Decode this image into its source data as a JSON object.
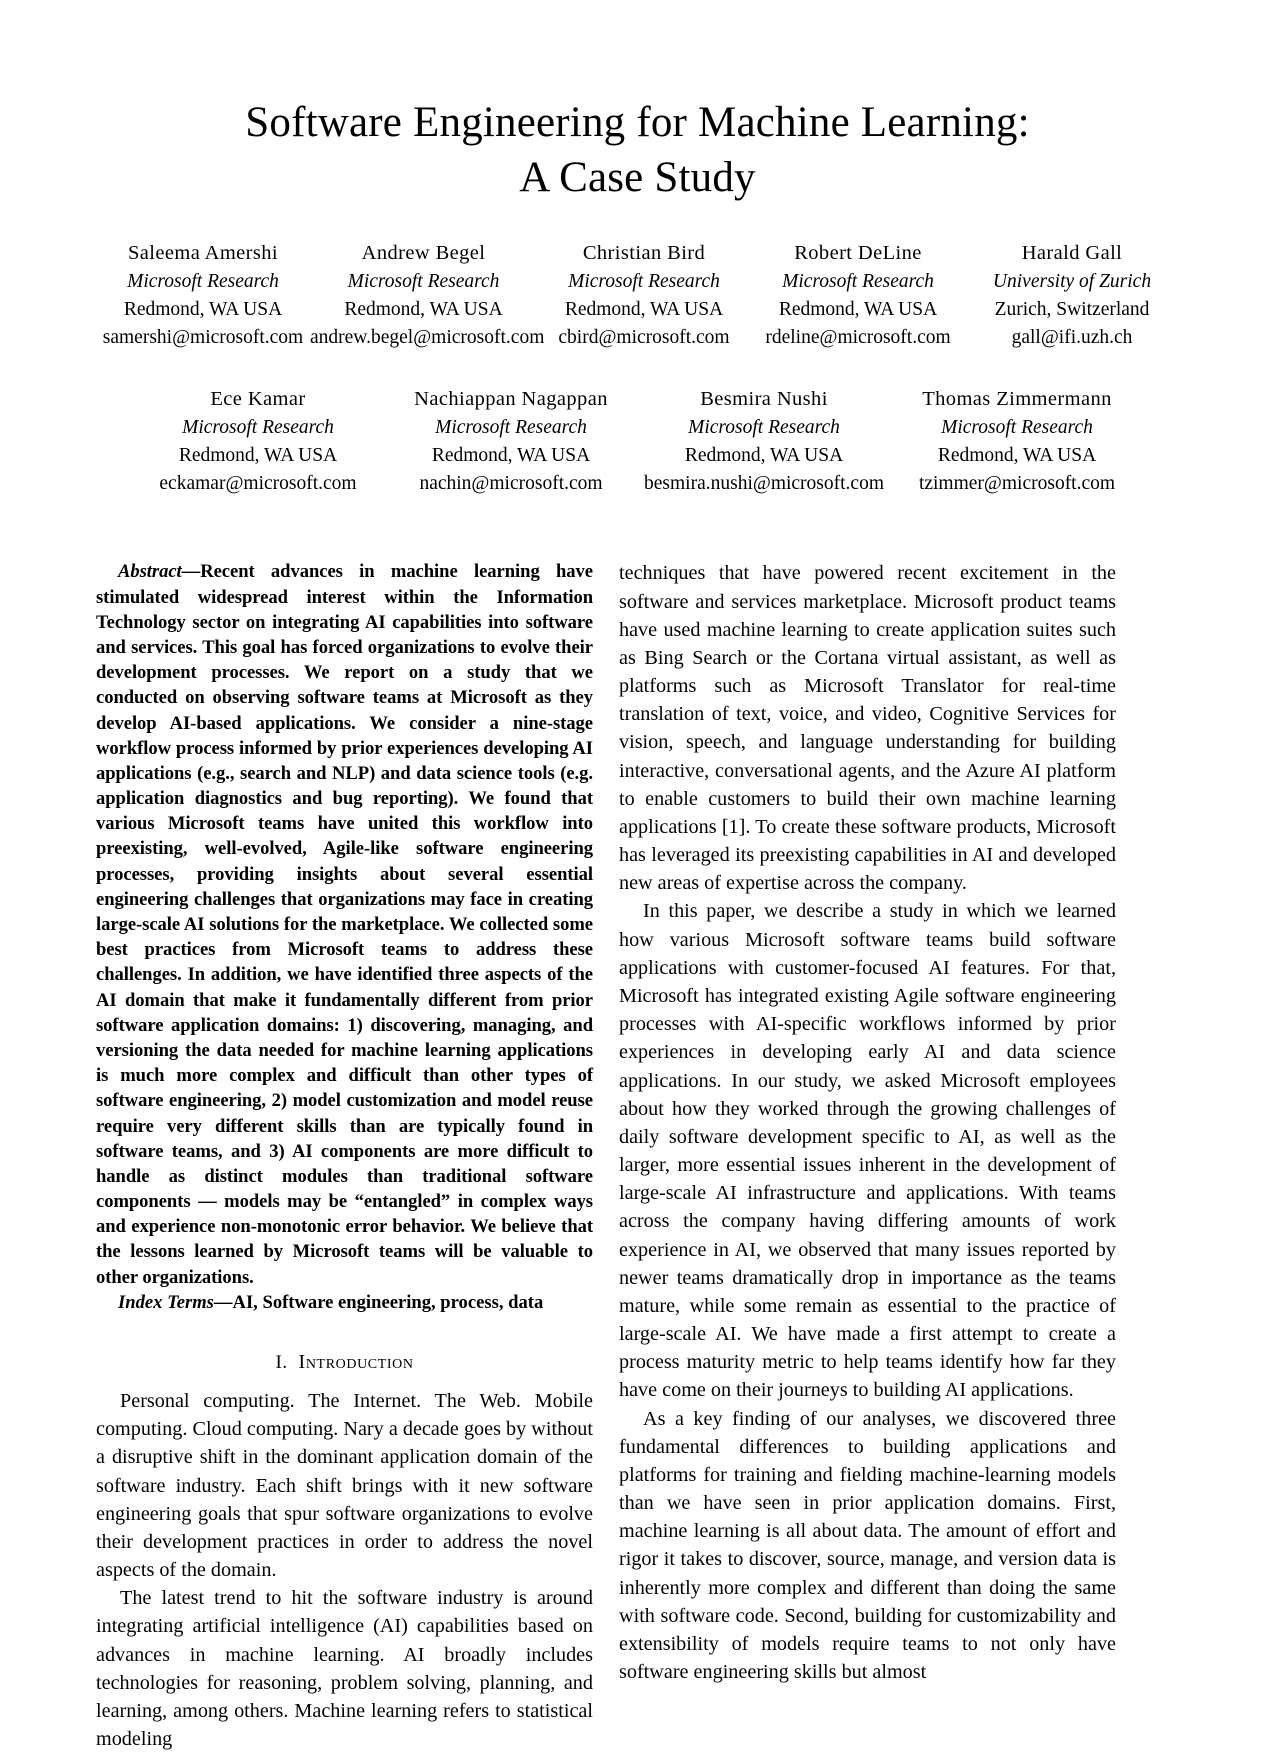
{
  "paper": {
    "title_lines": [
      "Software Engineering for Machine Learning:",
      "A Case Study"
    ],
    "authors_row1": [
      {
        "name": "Saleema Amershi",
        "affiliation": "Microsoft Research",
        "location": "Redmond, WA USA",
        "email": "samershi@microsoft.com"
      },
      {
        "name": "Andrew Begel",
        "affiliation": "Microsoft Research",
        "location": "Redmond, WA USA",
        "email": "andrew.begel@microsoft.com"
      },
      {
        "name": "Christian Bird",
        "affiliation": "Microsoft Research",
        "location": "Redmond, WA USA",
        "email": "cbird@microsoft.com"
      },
      {
        "name": "Robert DeLine",
        "affiliation": "Microsoft Research",
        "location": "Redmond, WA USA",
        "email": "rdeline@microsoft.com"
      },
      {
        "name": "Harald Gall",
        "affiliation": "University of Zurich",
        "location": "Zurich, Switzerland",
        "email": "gall@ifi.uzh.ch"
      }
    ],
    "authors_row2": [
      {
        "name": "Ece Kamar",
        "affiliation": "Microsoft Research",
        "location": "Redmond, WA USA",
        "email": "eckamar@microsoft.com"
      },
      {
        "name": "Nachiappan Nagappan",
        "affiliation": "Microsoft Research",
        "location": "Redmond, WA USA",
        "email": "nachin@microsoft.com"
      },
      {
        "name": "Besmira Nushi",
        "affiliation": "Microsoft Research",
        "location": "Redmond, WA USA",
        "email": "besmira.nushi@microsoft.com"
      },
      {
        "name": "Thomas Zimmermann",
        "affiliation": "Microsoft Research",
        "location": "Redmond, WA USA",
        "email": "tzimmer@microsoft.com"
      }
    ],
    "abstract": {
      "lead_label": "Abstract",
      "dash": "—",
      "text": "Recent advances in machine learning have stimulated widespread interest within the Information Technology sector on integrating AI capabilities into software and services. This goal has forced organizations to evolve their development processes. We report on a study that we conducted on observing software teams at Microsoft as they develop AI-based applications. We consider a nine-stage workflow process informed by prior experiences developing AI applications (e.g., search and NLP) and data science tools (e.g. application diagnostics and bug reporting). We found that various Microsoft teams have united this workflow into preexisting, well-evolved, Agile-like software engineering processes, providing insights about several essential engineering challenges that organizations may face in creating large-scale AI solutions for the marketplace. We collected some best practices from Microsoft teams to address these challenges. In addition, we have identified three aspects of the AI domain that make it fundamentally different from prior software application domains: 1) discovering, managing, and versioning the data needed for machine learning applications is much more complex and difficult than other types of software engineering, 2) model customization and model reuse require very different skills than are typically found in software teams, and 3) AI components are more difficult to handle as distinct modules than traditional software components — models may be “entangled” in complex ways and experience non-monotonic error behavior. We believe that the lessons learned by Microsoft teams will be valuable to other organizations."
    },
    "index_terms": {
      "lead_label": "Index Terms",
      "dash": "—",
      "text": "AI, Software engineering, process, data"
    },
    "section1": {
      "number": "I.",
      "title": "Introduction",
      "paragraphs": [
        "Personal computing. The Internet. The Web. Mobile computing. Cloud computing. Nary a decade goes by without a disruptive shift in the dominant application domain of the software industry. Each shift brings with it new software engineering goals that spur software organizations to evolve their development practices in order to address the novel aspects of the domain.",
        "The latest trend to hit the software industry is around integrating artificial intelligence (AI) capabilities based on advances in machine learning. AI broadly includes technologies for reasoning, problem solving, planning, and learning, among others. Machine learning refers to statistical modeling"
      ]
    },
    "right_column": {
      "paragraphs": [
        "techniques that have powered recent excitement in the software and services marketplace. Microsoft product teams have used machine learning to create application suites such as Bing Search or the Cortana virtual assistant, as well as platforms such as Microsoft Translator for real-time translation of text, voice, and video, Cognitive Services for vision, speech, and language understanding for building interactive, conversational agents, and the Azure AI platform to enable customers to build their own machine learning applications [1]. To create these software products, Microsoft has leveraged its preexisting capabilities in AI and developed new areas of expertise across the company.",
        "In this paper, we describe a study in which we learned how various Microsoft software teams build software applications with customer-focused AI features. For that, Microsoft has integrated existing Agile software engineering processes with AI-specific workflows informed by prior experiences in developing early AI and data science applications. In our study, we asked Microsoft employees about how they worked through the growing challenges of daily software development specific to AI, as well as the larger, more essential issues inherent in the development of large-scale AI infrastructure and applications. With teams across the company having differing amounts of work experience in AI, we observed that many issues reported by newer teams dramatically drop in importance as the teams mature, while some remain as essential to the practice of large-scale AI. We have made a first attempt to create a process maturity metric to help teams identify how far they have come on their journeys to building AI applications.",
        "As a key finding of our analyses, we discovered three fundamental differences to building applications and platforms for training and fielding machine-learning models than we have seen in prior application domains. First, machine learning is all about data. The amount of effort and rigor it takes to discover, source, manage, and version data is inherently more complex and different than doing the same with software code. Second, building for customizability and extensibility of models require teams to not only have software engineering skills but almost"
      ]
    }
  }
}
